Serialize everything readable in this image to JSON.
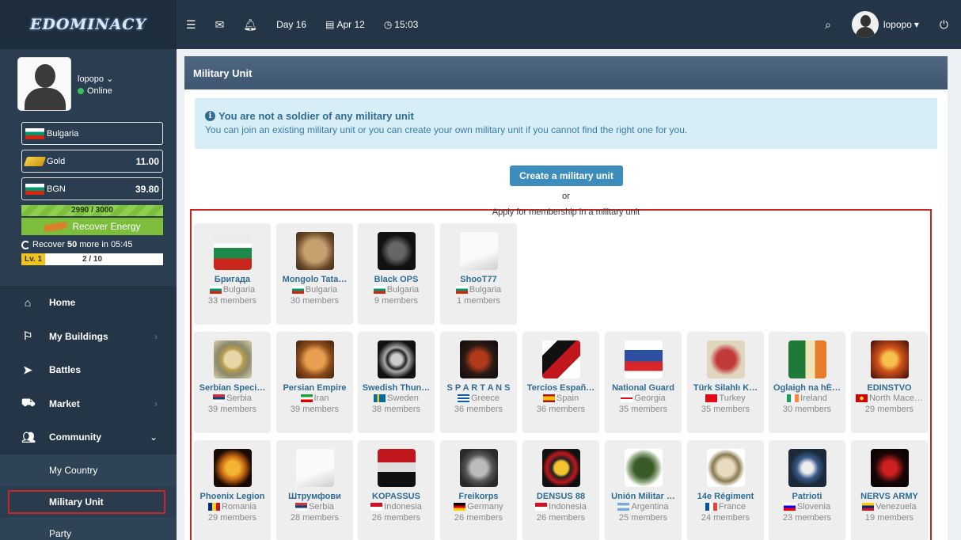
{
  "brand": {
    "logo": "EDOMINACY"
  },
  "topbar": {
    "day": "Day 16",
    "date": "Apr 12",
    "time": "15:03",
    "username": "lopopo"
  },
  "profile": {
    "name": "lopopo",
    "status": "Online",
    "country": "Bulgaria",
    "gold_label": "Gold",
    "gold_value": "11.00",
    "currency_label": "BGN",
    "currency_value": "39.80",
    "energy": "2990 / 3000",
    "energy_fraction": 0.997,
    "recover_button": "Recover Energy",
    "recover_prefix": "Recover",
    "recover_amount": "50",
    "recover_suffix": "more in 05:45",
    "level_label": "Lv. 1",
    "level_progress": "2 / 10"
  },
  "menu": {
    "home": "Home",
    "buildings": "My Buildings",
    "battles": "Battles",
    "market": "Market",
    "community": "Community",
    "sub_country": "My Country",
    "sub_military": "Military Unit",
    "sub_party": "Party"
  },
  "page": {
    "title": "Military Unit",
    "alert_title": "You are not a soldier of any military unit",
    "alert_text": "You can join an existing military unit or you can create your own military unit if you cannot find the right one for you.",
    "create_button": "Create a military unit",
    "or_text": "or",
    "apply_text": "Apply for membership in a military unit"
  },
  "units": [
    {
      "name": "Бригада",
      "country": "Bulgaria",
      "flag": "bg",
      "members": "33 members",
      "emblem": "flag-bg"
    },
    {
      "name": "Mongolo Tata…",
      "country": "Bulgaria",
      "flag": "bg",
      "members": "30 members",
      "emblem": "tank"
    },
    {
      "name": "Black OPS",
      "country": "Bulgaria",
      "flag": "bg",
      "members": "9 members",
      "emblem": "skull-dark"
    },
    {
      "name": "ShooT77",
      "country": "Bulgaria",
      "flag": "bg",
      "members": "1 members",
      "emblem": "white-flag"
    },
    {
      "name": "Serbian Speci…",
      "country": "Serbia",
      "flag": "rs",
      "members": "39 members",
      "emblem": "wreath"
    },
    {
      "name": "Persian Empire",
      "country": "Iran",
      "flag": "ir",
      "members": "39 members",
      "emblem": "lion"
    },
    {
      "name": "Swedish Thun…",
      "country": "Sweden",
      "flag": "se",
      "members": "38 members",
      "emblem": "celtic"
    },
    {
      "name": "S P A R T A N S",
      "country": "Greece",
      "flag": "gr",
      "members": "36 members",
      "emblem": "spartan"
    },
    {
      "name": "Tercios Españ…",
      "country": "Spain",
      "flag": "es",
      "members": "36 members",
      "emblem": "eagle-red"
    },
    {
      "name": "National Guard",
      "country": "Georgia",
      "flag": "ge",
      "members": "35 members",
      "emblem": "shield-blue"
    },
    {
      "name": "Türk Silahlı K…",
      "country": "Turkey",
      "flag": "tr",
      "members": "35 members",
      "emblem": "crest-red"
    },
    {
      "name": "Óglaigh na hÉ…",
      "country": "Ireland",
      "flag": "ie",
      "members": "30 members",
      "emblem": "shield-green"
    },
    {
      "name": "EDINSTVO",
      "country": "North Mace…",
      "flag": "mk",
      "members": "29 members",
      "emblem": "fire-lion"
    },
    {
      "name": "Phoenix Legion",
      "country": "Romania",
      "flag": "ro",
      "members": "29 members",
      "emblem": "phoenix"
    },
    {
      "name": "Штрумфови",
      "country": "Serbia",
      "flag": "rs",
      "members": "28 members",
      "emblem": "white-flag"
    },
    {
      "name": "KOPASSUS",
      "country": "Indonesia",
      "flag": "id",
      "members": "26 members",
      "emblem": "beret-skull"
    },
    {
      "name": "Freikorps",
      "country": "Germany",
      "flag": "de",
      "members": "26 members",
      "emblem": "eagle-gray"
    },
    {
      "name": "DENSUS 88",
      "country": "Indonesia",
      "flag": "id",
      "members": "26 members",
      "emblem": "owl"
    },
    {
      "name": "Unión Militar …",
      "country": "Argentina",
      "flag": "ar",
      "members": "25 members",
      "emblem": "soldiers"
    },
    {
      "name": "14e Régiment",
      "country": "France",
      "flag": "fr",
      "members": "24 members",
      "emblem": "badge-14"
    },
    {
      "name": "Patrioti",
      "country": "Slovenia",
      "flag": "si",
      "members": "23 members",
      "emblem": "round-badge"
    },
    {
      "name": "NERVS ARMY",
      "country": "Venezuela",
      "flag": "ve",
      "members": "19 members",
      "emblem": "nerv"
    }
  ]
}
